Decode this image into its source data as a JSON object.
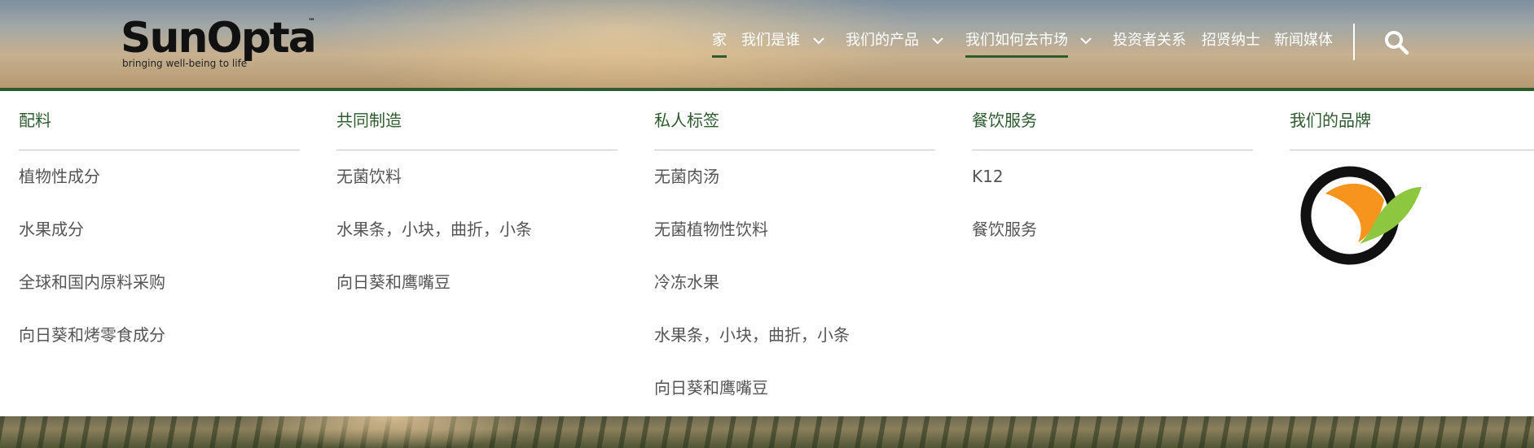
{
  "brand": {
    "name": "SunOpta",
    "tagline": "bringing well-being to life",
    "tm": "™"
  },
  "nav": {
    "items": [
      {
        "label": "家",
        "active": true,
        "has_dropdown": false
      },
      {
        "label": "我们是谁",
        "active": false,
        "has_dropdown": true
      },
      {
        "label": "我们的产品",
        "active": false,
        "has_dropdown": true
      },
      {
        "label": "我们如何去市场",
        "active": true,
        "has_dropdown": true
      },
      {
        "label": "投资者关系",
        "active": false,
        "has_dropdown": false
      },
      {
        "label": "招贤纳士",
        "active": false,
        "has_dropdown": false
      },
      {
        "label": "新闻媒体",
        "active": false,
        "has_dropdown": false
      }
    ],
    "search_icon": "search-icon"
  },
  "menu": {
    "columns": [
      {
        "title": "配料",
        "links": [
          "植物性成分",
          "水果成分",
          "全球和国内原料采购",
          "向日葵和烤零食成分"
        ]
      },
      {
        "title": "共同制造",
        "links": [
          "无菌饮料",
          "水果条，小块，曲折，小条",
          "向日葵和鹰嘴豆"
        ]
      },
      {
        "title": "私人标签",
        "links": [
          "无菌肉汤",
          "无菌植物性饮料",
          "冷冻水果",
          "水果条，小块，曲折，小条",
          "向日葵和鹰嘴豆"
        ]
      },
      {
        "title": "餐饮服务",
        "links": [
          "K12",
          "餐饮服务"
        ]
      },
      {
        "title": "我们的品牌",
        "links": []
      }
    ]
  },
  "colors": {
    "accent_green": "#2d5a2e",
    "logo_orange": "#f7941d",
    "logo_leaf": "#8dc63f",
    "link_gray": "#555555"
  }
}
